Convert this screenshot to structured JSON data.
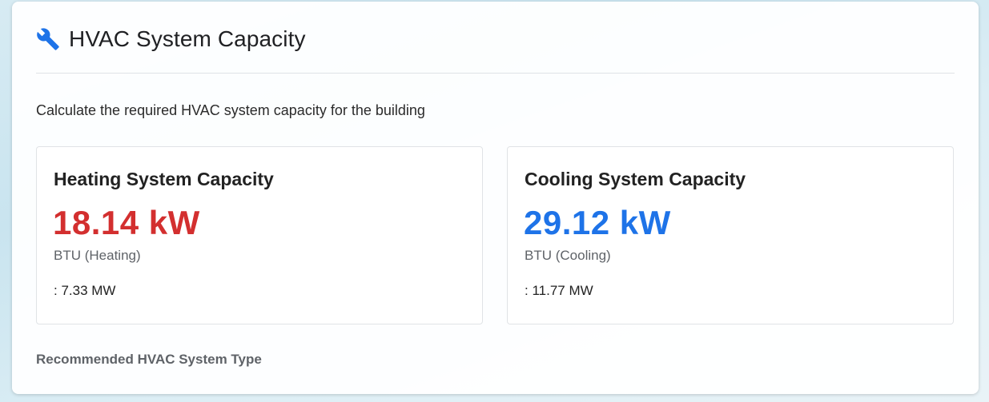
{
  "header": {
    "icon": "wrench-icon",
    "title": "HVAC System Capacity",
    "accent_color": "#1e73e8"
  },
  "description": "Calculate the required HVAC system capacity for the building",
  "panels": [
    {
      "title": "Heating System Capacity",
      "value": "18.14 kW",
      "unit_label": "BTU (Heating)",
      "secondary": ": 7.33 MW",
      "color": "#d32f2f"
    },
    {
      "title": "Cooling System Capacity",
      "value": "29.12 kW",
      "unit_label": "BTU (Cooling)",
      "secondary": ": 11.77 MW",
      "color": "#1e73e8"
    }
  ],
  "recommendation_label": "Recommended HVAC System Type"
}
